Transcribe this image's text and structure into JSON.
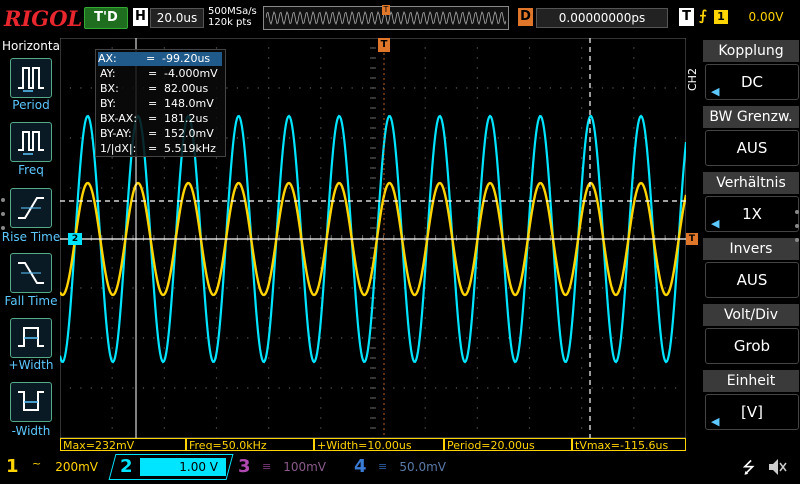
{
  "topbar": {
    "logo": "RIGOL",
    "trigger_state": "T'D",
    "timebase_label": "H",
    "timebase_value": "20.0us",
    "sample_rate": "500MSa/s",
    "memory_depth": "120k pts",
    "delay_label": "D",
    "delay_value": "0.00000000ps",
    "trigger_label": "T",
    "trigger_source": "1",
    "trigger_level": "0.00V"
  },
  "left_menu": {
    "title": "Horizontal",
    "items": [
      {
        "label": "Period",
        "icon": "period-icon"
      },
      {
        "label": "Freq",
        "icon": "freq-icon"
      },
      {
        "label": "Rise Time",
        "icon": "rise-time-icon"
      },
      {
        "label": "Fall Time",
        "icon": "fall-time-icon"
      },
      {
        "label": "+Width",
        "icon": "pos-width-icon"
      },
      {
        "label": "-Width",
        "icon": "neg-width-icon"
      }
    ]
  },
  "cursor_table": {
    "rows": [
      {
        "k": "AX:",
        "v": "-99.20us"
      },
      {
        "k": "AY:",
        "v": "-4.000mV"
      },
      {
        "k": "BX:",
        "v": "82.00us"
      },
      {
        "k": "BY:",
        "v": "148.0mV"
      },
      {
        "k": "BX-AX:",
        "v": "181.2us"
      },
      {
        "k": "BY-AY:",
        "v": "152.0mV"
      },
      {
        "k": "1/|dX|:",
        "v": "5.519kHz"
      }
    ]
  },
  "markers": {
    "ch2_marker": "2",
    "trigger_marker": "T"
  },
  "right_menu": {
    "tab": "CH2",
    "items": [
      {
        "title": "Kopplung",
        "value": "DC",
        "arrow": true
      },
      {
        "title": "BW Grenzw.",
        "value": "AUS",
        "arrow": false
      },
      {
        "title": "Verhältnis",
        "value": "1X",
        "arrow": true
      },
      {
        "title": "Invers",
        "value": "AUS",
        "arrow": false
      },
      {
        "title": "Volt/Div",
        "value": "Grob",
        "arrow": false
      },
      {
        "title": "Einheit",
        "value": "[V]",
        "arrow": true
      }
    ]
  },
  "measurements": [
    "Max=232mV",
    "Freq=50.0kHz",
    "+Width=10.00us",
    "Period=20.00us",
    "tVmax=-115.6us"
  ],
  "channels": [
    {
      "num": "1",
      "coupling": "~",
      "scale": "200mV",
      "color": "#ffd400",
      "active": false
    },
    {
      "num": "2",
      "coupling": "≡",
      "scale": "1.00 V",
      "color": "#00e5ff",
      "active": true
    },
    {
      "num": "3",
      "coupling": "≡",
      "scale": "100mV",
      "color": "#b04ab0",
      "active": false
    },
    {
      "num": "4",
      "coupling": "≡",
      "scale": "50.0mV",
      "color": "#3a7bd5",
      "active": false
    }
  ],
  "waveforms": {
    "ch1": {
      "color": "#ffd400",
      "frequency_khz": 50,
      "amplitude_v": 0.232
    },
    "ch2": {
      "color": "#00e5ff",
      "frequency_khz": 50
    }
  }
}
